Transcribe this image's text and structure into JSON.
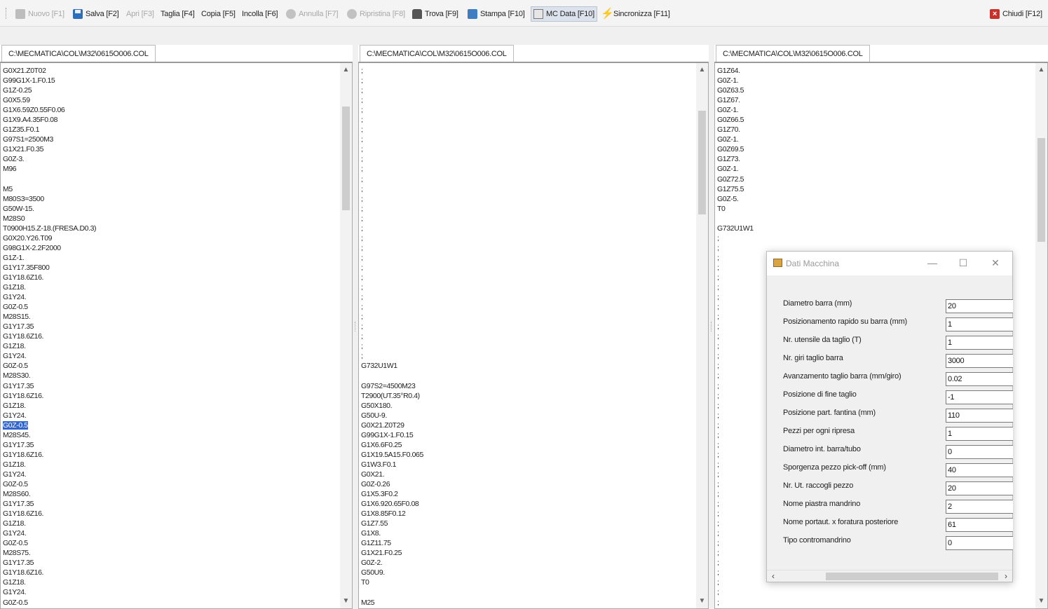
{
  "toolbar": {
    "buttons": [
      {
        "label": "Nuovo [F1]",
        "icon": "new-file-icon",
        "enabled": false
      },
      {
        "label": "Salva [F2]",
        "icon": "save-icon",
        "enabled": true
      },
      {
        "label": "Apri [F3]",
        "icon": "",
        "enabled": false
      },
      {
        "label": "Taglia [F4]",
        "icon": "",
        "enabled": true
      },
      {
        "label": "Copia [F5]",
        "icon": "",
        "enabled": true
      },
      {
        "label": "Incolla [F6]",
        "icon": "",
        "enabled": true
      },
      {
        "label": "Annulla [F7]",
        "icon": "undo-icon",
        "enabled": false
      },
      {
        "label": "Ripristina [F8]",
        "icon": "redo-icon",
        "enabled": false
      },
      {
        "label": "Trova [F9]",
        "icon": "binoculars-icon",
        "enabled": true
      },
      {
        "label": "Stampa [F10]",
        "icon": "printer-icon",
        "enabled": true
      },
      {
        "label": "MC Data [F10]",
        "icon": "machine-data-icon",
        "enabled": true,
        "active": true
      },
      {
        "label": "Sincronizza [F11]",
        "icon": "lightning-icon",
        "enabled": true
      }
    ],
    "close_label": "Chiudi [F12]"
  },
  "panels": [
    {
      "tab": "C:\\MECMATICA\\COL\\M32\\0615O006.COL",
      "selected_line": 36,
      "lines": [
        "G0X21.Z0T02",
        "G99G1X-1.F0.15",
        "G1Z-0.25",
        "G0X5.59",
        "G1X6.59Z0.55F0.06",
        "G1X9.A4.35F0.08",
        "G1Z35.F0.1",
        "G97S1=2500M3",
        "G1X21.F0.35",
        "G0Z-3.",
        "M96",
        "",
        "M5",
        "M80S3=3500",
        "G50W-15.",
        "M28S0",
        "T0900H15.Z-18.(FRESA.D0.3)",
        "G0X20.Y26.T09",
        "G98G1X-2.2F2000",
        "G1Z-1.",
        "G1Y17.35F800",
        "G1Y18.6Z16.",
        "G1Z18.",
        "G1Y24.",
        "G0Z-0.5",
        "M28S15.",
        "G1Y17.35",
        "G1Y18.6Z16.",
        "G1Z18.",
        "G1Y24.",
        "G0Z-0.5",
        "M28S30.",
        "G1Y17.35",
        "G1Y18.6Z16.",
        "G1Z18.",
        "G1Y24.",
        "G0Z-0.5",
        "M28S45.",
        "G1Y17.35",
        "G1Y18.6Z16.",
        "G1Z18.",
        "G1Y24.",
        "G0Z-0.5",
        "M28S60.",
        "G1Y17.35",
        "G1Y18.6Z16.",
        "G1Z18.",
        "G1Y24.",
        "G0Z-0.5",
        "M28S75.",
        "G1Y17.35",
        "G1Y18.6Z16.",
        "G1Z18.",
        "G1Y24.",
        "G0Z-0.5"
      ]
    },
    {
      "tab": "C:\\MECMATICA\\COL\\M32\\0615O006.COL",
      "selected_line": -1,
      "lines": [
        ";",
        ";",
        ";",
        ";",
        ";",
        ";",
        ";",
        ";",
        ";",
        ";",
        ";",
        ";",
        ";",
        ";",
        ";",
        ";",
        ";",
        ";",
        ";",
        ";",
        ";",
        ";",
        ";",
        ";",
        ";",
        ";",
        ";",
        ";",
        ";",
        ";",
        "G732U1W1",
        "",
        "G97S2=4500M23",
        "T2900(UT.35°R0.4)",
        "G50X180.",
        "G50U-9.",
        "G0X21.Z0T29",
        "G99G1X-1.F0.15",
        "G1X6.6F0.25",
        "G1X19.5A15.F0.065",
        "G1W3.F0.1",
        "G0X21.",
        "G0Z-0.26",
        "G1X5.3F0.2",
        "G1X6.920.65F0.08",
        "G1X8.85F0.12",
        "G1Z7.55",
        "G1X8.",
        "G1Z11.75",
        "G1X21.F0.25",
        "G0Z-2.",
        "G50U9.",
        "T0",
        "",
        "M25"
      ]
    },
    {
      "tab": "C:\\MECMATICA\\COL\\M32\\0615O006.COL",
      "selected_line": -1,
      "lines": [
        "G1Z64.",
        "G0Z-1.",
        "G0Z63.5",
        "G1Z67.",
        "G0Z-1.",
        "G0Z66.5",
        "G1Z70.",
        "G0Z-1.",
        "G0Z69.5",
        "G1Z73.",
        "G0Z-1.",
        "G0Z72.5",
        "G1Z75.5",
        "G0Z-5.",
        "T0",
        "",
        "G732U1W1",
        ";",
        ";",
        ";",
        ";",
        ";",
        ";",
        ";",
        ";",
        ";",
        ";",
        ";",
        ";",
        ";",
        ";",
        ";",
        ";",
        ";",
        ";",
        ";",
        ";",
        ";",
        ";",
        ";",
        ";",
        ";",
        ";",
        ";",
        ";",
        ";",
        ";",
        ";",
        ";",
        ";",
        ";",
        ";",
        ";",
        ";",
        ";"
      ]
    }
  ],
  "dialog": {
    "title": "Dati Macchina",
    "fields": [
      {
        "label": "Diametro barra (mm)",
        "value": "20"
      },
      {
        "label": "Posizionamento rapido su barra (mm)",
        "value": "1"
      },
      {
        "label": "Nr. utensile da taglio (T)",
        "value": "1"
      },
      {
        "label": "Nr. giri taglio barra",
        "value": "3000"
      },
      {
        "label": "Avanzamento taglio barra (mm/giro)",
        "value": "0.02"
      },
      {
        "label": "Posizione di fine taglio",
        "value": "-1"
      },
      {
        "label": "Posizione part. fantina (mm)",
        "value": "110"
      },
      {
        "label": "Pezzi per ogni ripresa",
        "value": "1"
      },
      {
        "label": "Diametro int. barra/tubo",
        "value": "0"
      },
      {
        "label": "Sporgenza pezzo pick-off (mm)",
        "value": "40"
      },
      {
        "label": "Nr. Ut. raccogli pezzo",
        "value": "20"
      },
      {
        "label": "Nome piastra mandrino",
        "value": "2"
      },
      {
        "label": "Nome portaut. x foratura posteriore",
        "value": "61"
      },
      {
        "label": "Tipo contromandrino",
        "value": "0"
      }
    ]
  }
}
